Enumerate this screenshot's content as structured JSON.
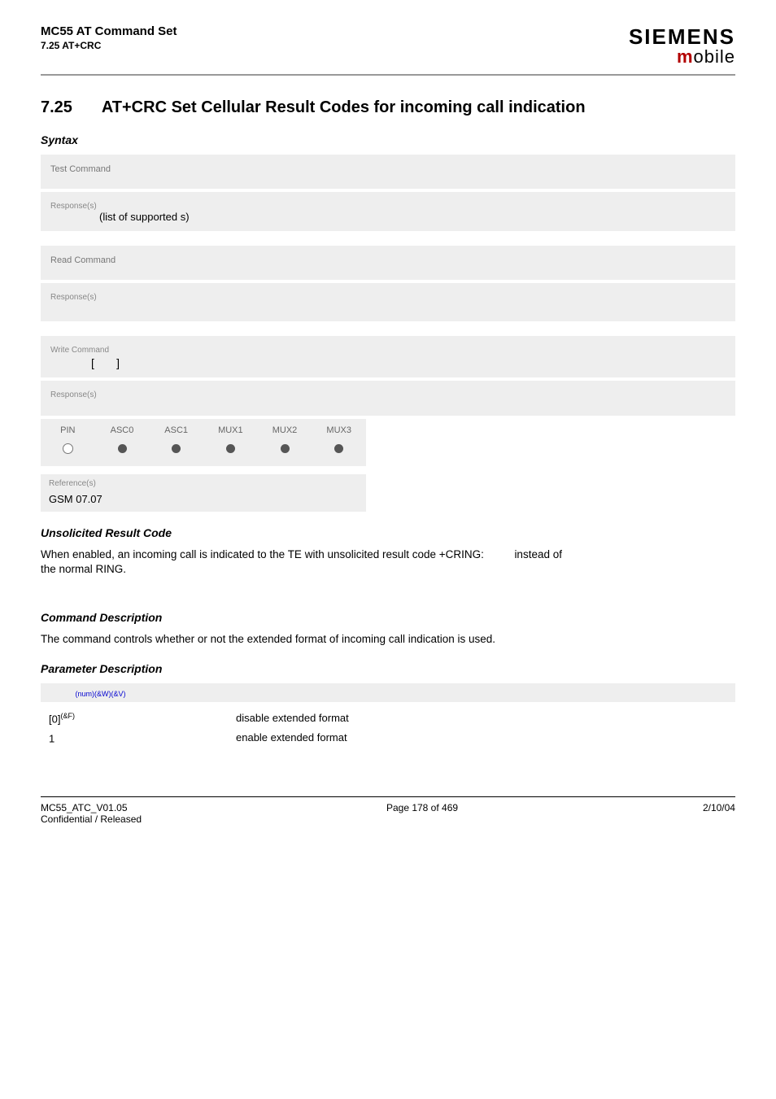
{
  "header": {
    "doc_title": "MC55 AT Command Set",
    "doc_sub": "7.25 AT+CRC",
    "brand_main": "SIEMENS",
    "brand_mobile_m": "m",
    "brand_mobile_rest": "obile"
  },
  "title": {
    "number": "7.25",
    "text": "AT+CRC   Set Cellular Result Codes for incoming call indication"
  },
  "labels": {
    "syntax": "Syntax",
    "test_command": "Test Command",
    "read_command": "Read Command",
    "write_command": "Write Command",
    "responses": "Response(s)",
    "references": "Reference(s)",
    "urc": "Unsolicited Result Code",
    "cmd_desc": "Command Description",
    "param_desc": "Parameter Description"
  },
  "test_response": {
    "prefix": "(list of supported ",
    "suffix": "s)"
  },
  "write_command_body": {
    "lbr": "[",
    "rbr": "]"
  },
  "matrix": {
    "headers": [
      "PIN",
      "ASC0",
      "ASC1",
      "MUX1",
      "MUX2",
      "MUX3"
    ],
    "values": [
      "open",
      "filled",
      "filled",
      "filled",
      "filled",
      "filled"
    ]
  },
  "reference": "GSM 07.07",
  "urc_text_1": "When enabled, an incoming call is indicated to the TE with unsolicited result code +CRING:",
  "urc_text_2": "instead of",
  "urc_text_3": "the normal RING.",
  "cmd_desc_text": "The command controls whether or not the extended format of incoming call indication is used.",
  "param": {
    "sup": "(num)(&W)(&V)",
    "rows": [
      {
        "key_prefix": "[0]",
        "key_sup": "(&F)",
        "val": "disable extended format"
      },
      {
        "key_prefix": "1",
        "key_sup": "",
        "val": "enable extended format"
      }
    ]
  },
  "footer": {
    "left1": "MC55_ATC_V01.05",
    "left2": "Confidential / Released",
    "center": "Page 178 of 469",
    "right": "2/10/04"
  }
}
